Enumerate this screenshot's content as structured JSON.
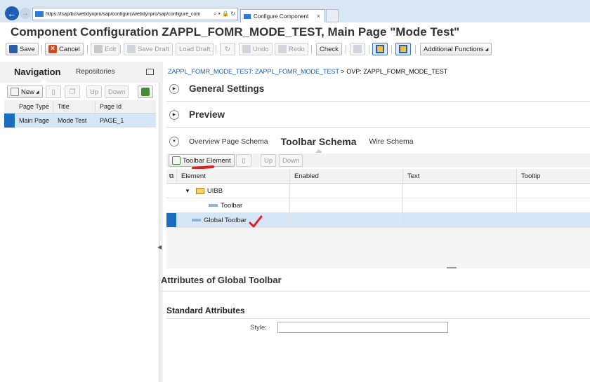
{
  "browser": {
    "address": "https://lsap/bc/webdynpro/sap/configurc/webdynpro/sap/configure_com",
    "address_tools": "⌕ ▾ 🔒 ↻",
    "tab_label": "Configure Component",
    "tab_close": "×"
  },
  "app": {
    "title": "Component Configuration ZAPPL_FOMR_MODE_TEST, Main Page \"Mode Test\""
  },
  "toolbar": {
    "save": "Save",
    "cancel": "Cancel",
    "edit": "Edit",
    "save_draft": "Save Draft",
    "load_draft": "Load Draft",
    "undo": "Undo",
    "redo": "Redo",
    "check": "Check",
    "additional_functions": "Additional Functions"
  },
  "navigation": {
    "tab_navigation": "Navigation",
    "tab_repositories": "Repositories",
    "new": "New",
    "up": "Up",
    "down": "Down",
    "columns": [
      "Page Type",
      "Title",
      "Page Id"
    ],
    "rows": [
      {
        "page_type": "Main Page",
        "title": "Mode Test",
        "page_id": "PAGE_1"
      }
    ]
  },
  "breadcrumb": {
    "link": "ZAPPL_FOMR_MODE_TEST: ZAPPL_FOMR_MODE_TEST",
    "separator": ">",
    "current": "OVP: ZAPPL_FOMR_MODE_TEST"
  },
  "panels": {
    "general_settings": "General Settings",
    "preview": "Preview"
  },
  "schema_tabs": {
    "overview": "Overview Page Schema",
    "toolbar": "Toolbar Schema",
    "wire": "Wire Schema"
  },
  "schema_toolbar": {
    "toolbar_element": "Toolbar Element",
    "up": "Up",
    "down": "Down"
  },
  "schema_grid": {
    "columns": [
      "Element",
      "Enabled",
      "Text",
      "Tooltip"
    ],
    "rows": [
      {
        "element": "UIBB"
      },
      {
        "element": "Toolbar"
      },
      {
        "element": "Global Toolbar"
      }
    ]
  },
  "attributes": {
    "title": "Attributes of Global Toolbar",
    "standard_title": "Standard Attributes",
    "style_label": "Style:",
    "style_value": ""
  },
  "colors": {
    "selection_accent": "#1a6ec0",
    "selected_row": "#d5e6f7",
    "annotation_red": "#e02020"
  }
}
